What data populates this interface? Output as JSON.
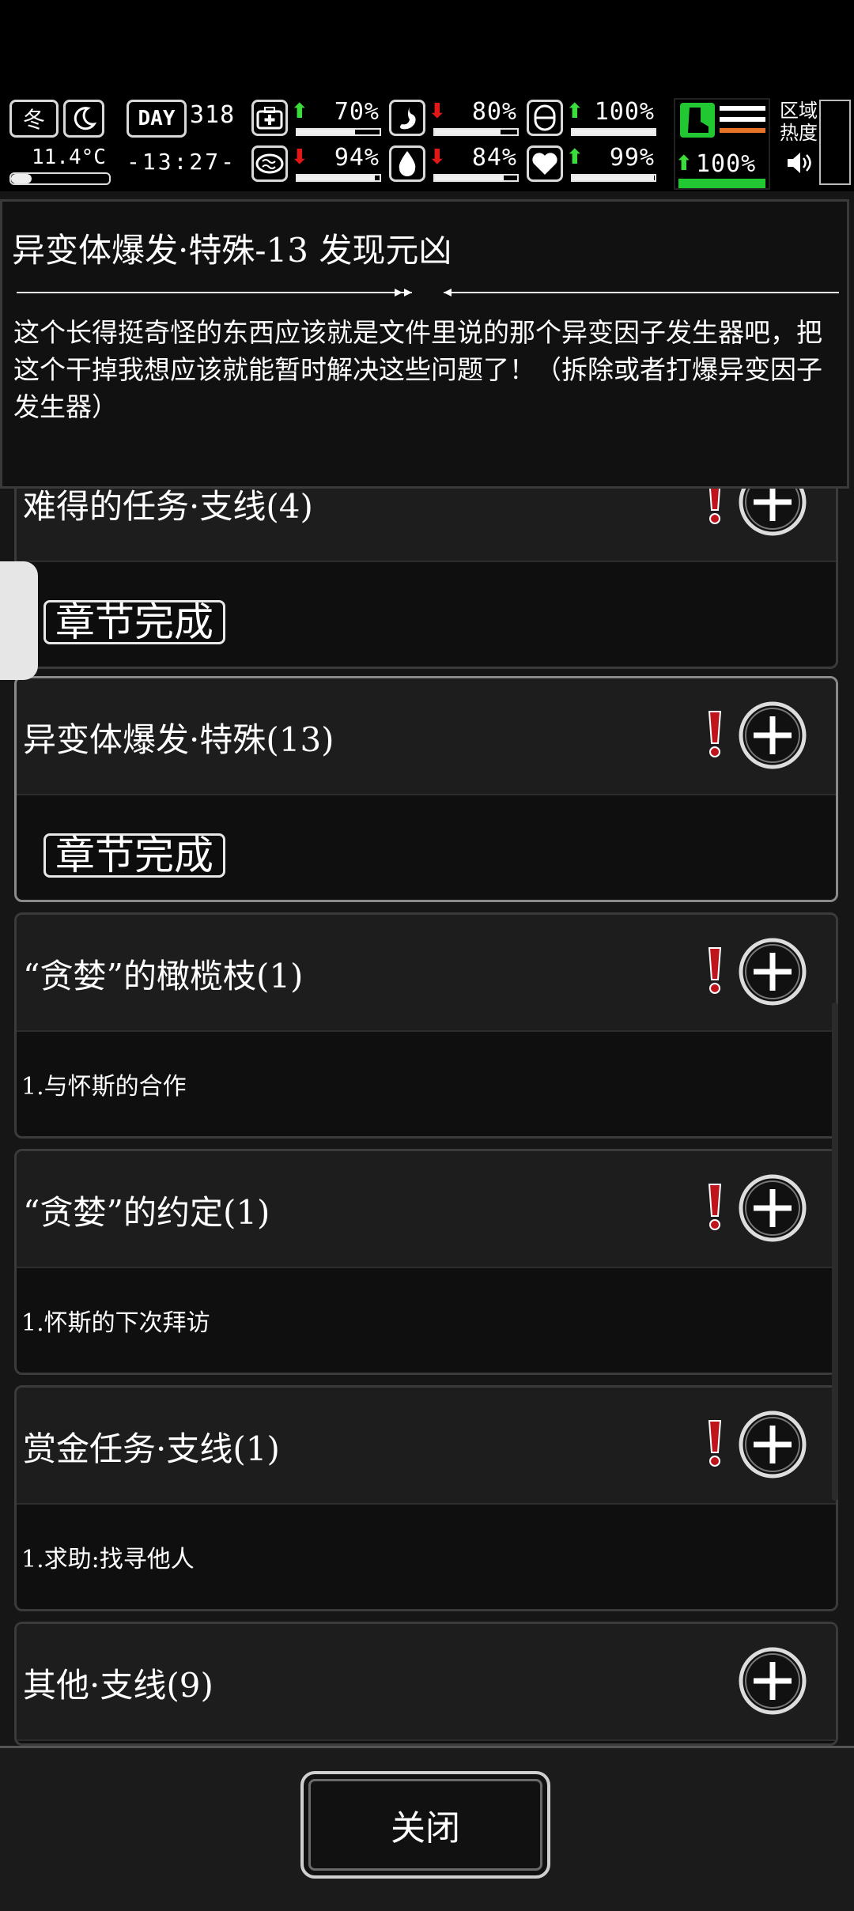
{
  "hud": {
    "season": "冬",
    "temperature": "11.4°C",
    "day_label": "DAY",
    "day_number": "318",
    "clock": "-13:27-",
    "stats": [
      {
        "icon": "medkit-icon",
        "trend": "up",
        "value": "70%",
        "level": 0.7
      },
      {
        "icon": "stomach-icon",
        "trend": "down",
        "value": "80%",
        "level": 0.8
      },
      {
        "icon": "capsule-icon",
        "trend": "up",
        "value": "100%",
        "level": 1.0
      },
      {
        "icon": "brain-icon",
        "trend": "down",
        "value": "94%",
        "level": 0.94
      },
      {
        "icon": "water-drop-icon",
        "trend": "down",
        "value": "84%",
        "level": 0.84
      },
      {
        "icon": "heart-icon",
        "trend": "up",
        "value": "99%",
        "level": 0.99
      }
    ],
    "stamina": {
      "icon": "boot-icon",
      "trend": "up",
      "value": "100%",
      "level": 1.0
    },
    "area_heat_label": "区域\n热度"
  },
  "popup": {
    "title": "异变体爆发·特殊-13 发现元凶",
    "body": "这个长得挺奇怪的东西应该就是文件里说的那个异变因子发生器吧，把这个干掉我想应该就能暂时解决这些问题了！（拆除或者打爆异变因子发生器）"
  },
  "quests": [
    {
      "title": "难得的任务·支线(4)",
      "badge": "章节完成",
      "sub": "",
      "alert": true
    },
    {
      "title": "异变体爆发·特殊(13)",
      "badge": "章节完成",
      "sub": "",
      "alert": true
    },
    {
      "title": "“贪婪”的橄榄枝(1)",
      "badge": "",
      "sub": "1.与怀斯的合作",
      "alert": true
    },
    {
      "title": "“贪婪”的约定(1)",
      "badge": "",
      "sub": "1.怀斯的下次拜访",
      "alert": true
    },
    {
      "title": "赏金任务·支线(1)",
      "badge": "",
      "sub": "1.求助:找寻他人",
      "alert": true
    },
    {
      "title": "其他·支线(9)",
      "badge": "",
      "sub": "",
      "alert": false
    }
  ],
  "close_label": "关闭",
  "colors": {
    "up": "#3ddc3d",
    "down": "#e01818",
    "alert": "#c0141c",
    "stamina": "#22c832"
  }
}
